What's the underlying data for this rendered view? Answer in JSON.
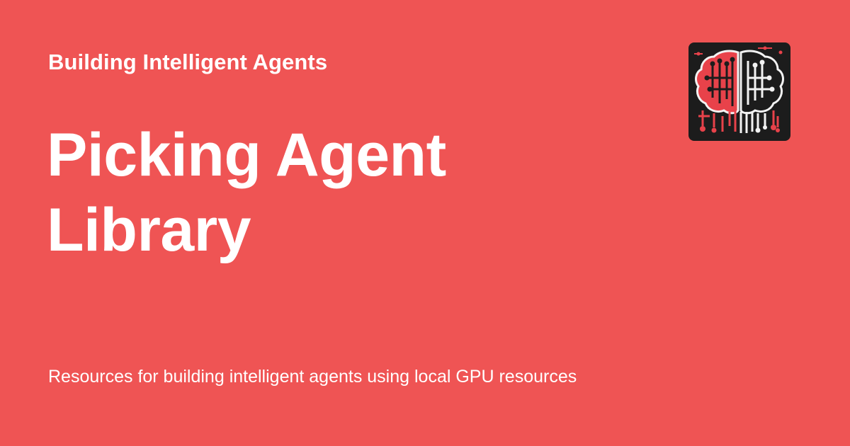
{
  "site": {
    "title": "Building Intelligent Agents"
  },
  "page": {
    "title": "Picking Agent Library",
    "description": "Resources for building intelligent agents using local GPU resources"
  },
  "logo": {
    "icon": "brain-circuit-icon"
  },
  "colors": {
    "background": "#ef5454",
    "text": "#ffffff",
    "logo_bg": "#1c1c1c",
    "logo_red": "#e8424a",
    "logo_white": "#f2f2f2"
  }
}
